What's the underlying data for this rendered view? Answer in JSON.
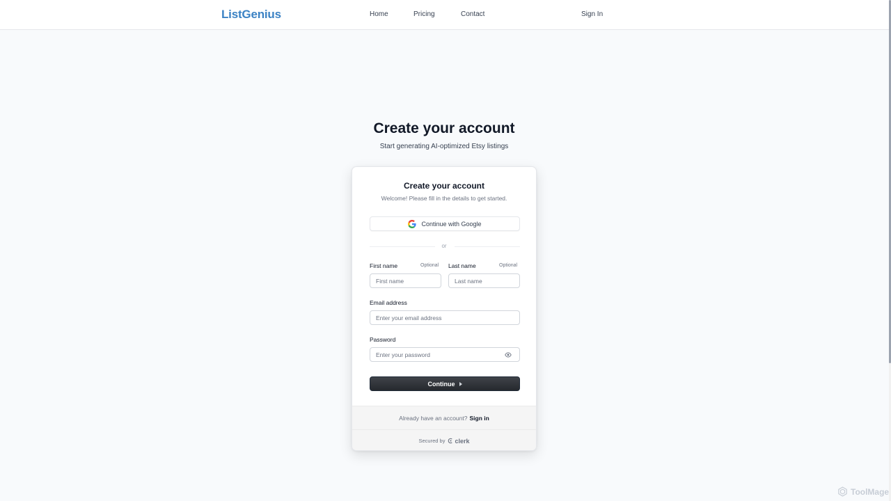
{
  "header": {
    "brand": "ListGenius",
    "nav": {
      "home": "Home",
      "pricing": "Pricing",
      "contact": "Contact"
    },
    "sign_in": "Sign In"
  },
  "page": {
    "title": "Create your account",
    "subtitle": "Start generating AI-optimized Etsy listings"
  },
  "card": {
    "title": "Create your account",
    "subtitle": "Welcome! Please fill in the details to get started.",
    "google_button": "Continue with Google",
    "divider": "or",
    "first_name": {
      "label": "First name",
      "optional": "Optional",
      "placeholder": "First name",
      "value": ""
    },
    "last_name": {
      "label": "Last name",
      "optional": "Optional",
      "placeholder": "Last name",
      "value": ""
    },
    "email": {
      "label": "Email address",
      "placeholder": "Enter your email address",
      "value": ""
    },
    "password": {
      "label": "Password",
      "placeholder": "Enter your password",
      "value": ""
    },
    "continue_button": "Continue",
    "footer": {
      "prompt": "Already have an account?",
      "sign_in_link": "Sign in",
      "secured_by": "Secured by",
      "clerk": "clerk"
    }
  },
  "watermark": "ToolMage",
  "colors": {
    "brand": "#3b82c4",
    "background": "#f8fafc",
    "primary_button": "#2f3237"
  },
  "icons": {
    "google": "google-icon",
    "eye": "eye-icon",
    "caret": "caret-right-icon",
    "clerk": "clerk-logo-icon",
    "watermark": "toolmage-logo-icon"
  }
}
